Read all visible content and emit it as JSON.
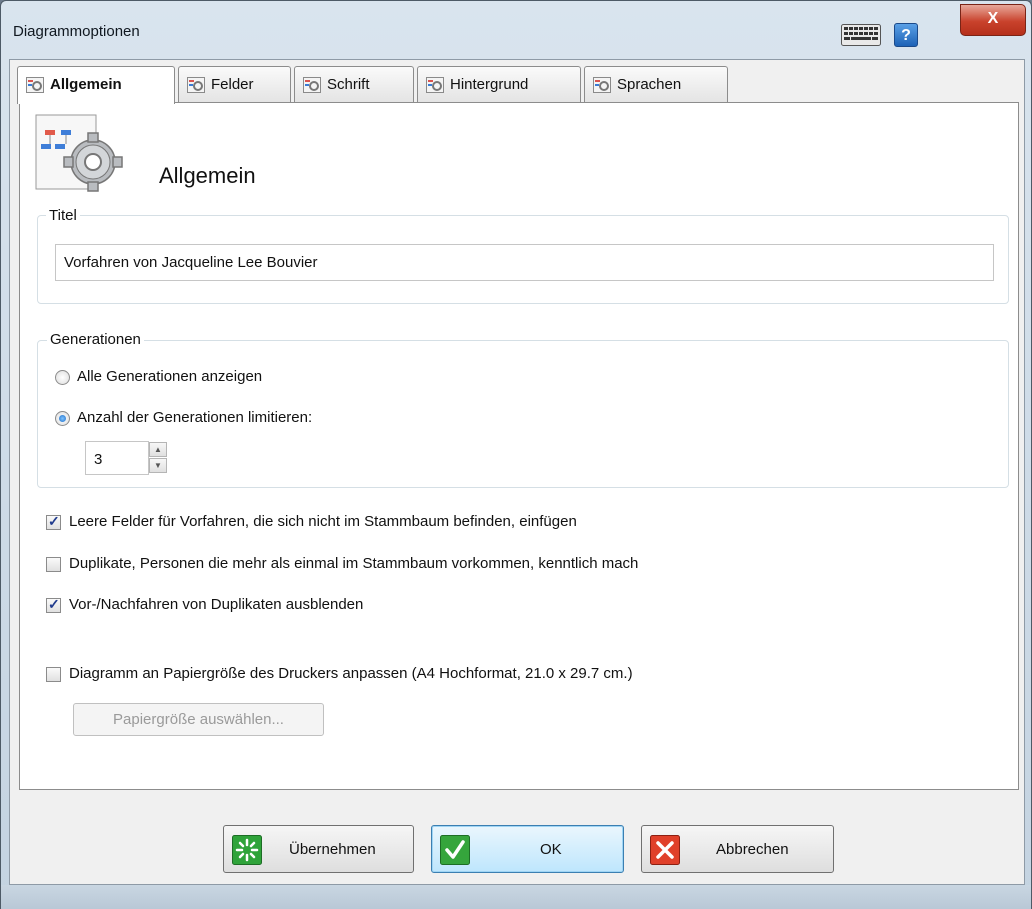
{
  "window": {
    "title": "Diagrammoptionen",
    "close_symbol": "X",
    "help_symbol": "?"
  },
  "tabs": [
    {
      "label": "Allgemein",
      "icon": "gear-tab-icon",
      "active": true
    },
    {
      "label": "Felder",
      "icon": "gear-tab-icon",
      "active": false
    },
    {
      "label": "Schrift",
      "icon": "gear-tab-icon",
      "active": false
    },
    {
      "label": "Hintergrund",
      "icon": "gear-tab-icon",
      "active": false
    },
    {
      "label": "Sprachen",
      "icon": "gear-tab-icon",
      "active": false
    }
  ],
  "header": {
    "title": "Allgemein",
    "icon": "chart-settings-icon"
  },
  "titel_group": {
    "legend": "Titel",
    "value": "Vorfahren von Jacqueline Lee Bouvier"
  },
  "generations": {
    "legend": "Generationen",
    "option_all": "Alle Generationen anzeigen",
    "option_limit": "Anzahl der Generationen limitieren:",
    "selected": "limit",
    "count": "3"
  },
  "checkboxes": [
    {
      "label": "Leere Felder für Vorfahren, die sich nicht im Stammbaum befinden, einfügen",
      "checked": true
    },
    {
      "label": "Duplikate, Personen die mehr als einmal im Stammbaum vorkommen, kenntlich mach",
      "checked": false
    },
    {
      "label": "Vor-/Nachfahren von Duplikaten ausblenden",
      "checked": true
    },
    {
      "label": "Diagramm an Papiergröße des Druckers anpassen (A4 Hochformat, 21.0 x 29.7 cm.)",
      "checked": false
    }
  ],
  "paper_button": "Papiergröße auswählen...",
  "buttons": {
    "apply": "Übernehmen",
    "ok": "OK",
    "cancel": "Abbrechen"
  },
  "colors": {
    "accent": "#1c6cc8",
    "apply_green": "#2fa33a",
    "ok_green": "#35a53c",
    "cancel_red": "#e0402a"
  }
}
